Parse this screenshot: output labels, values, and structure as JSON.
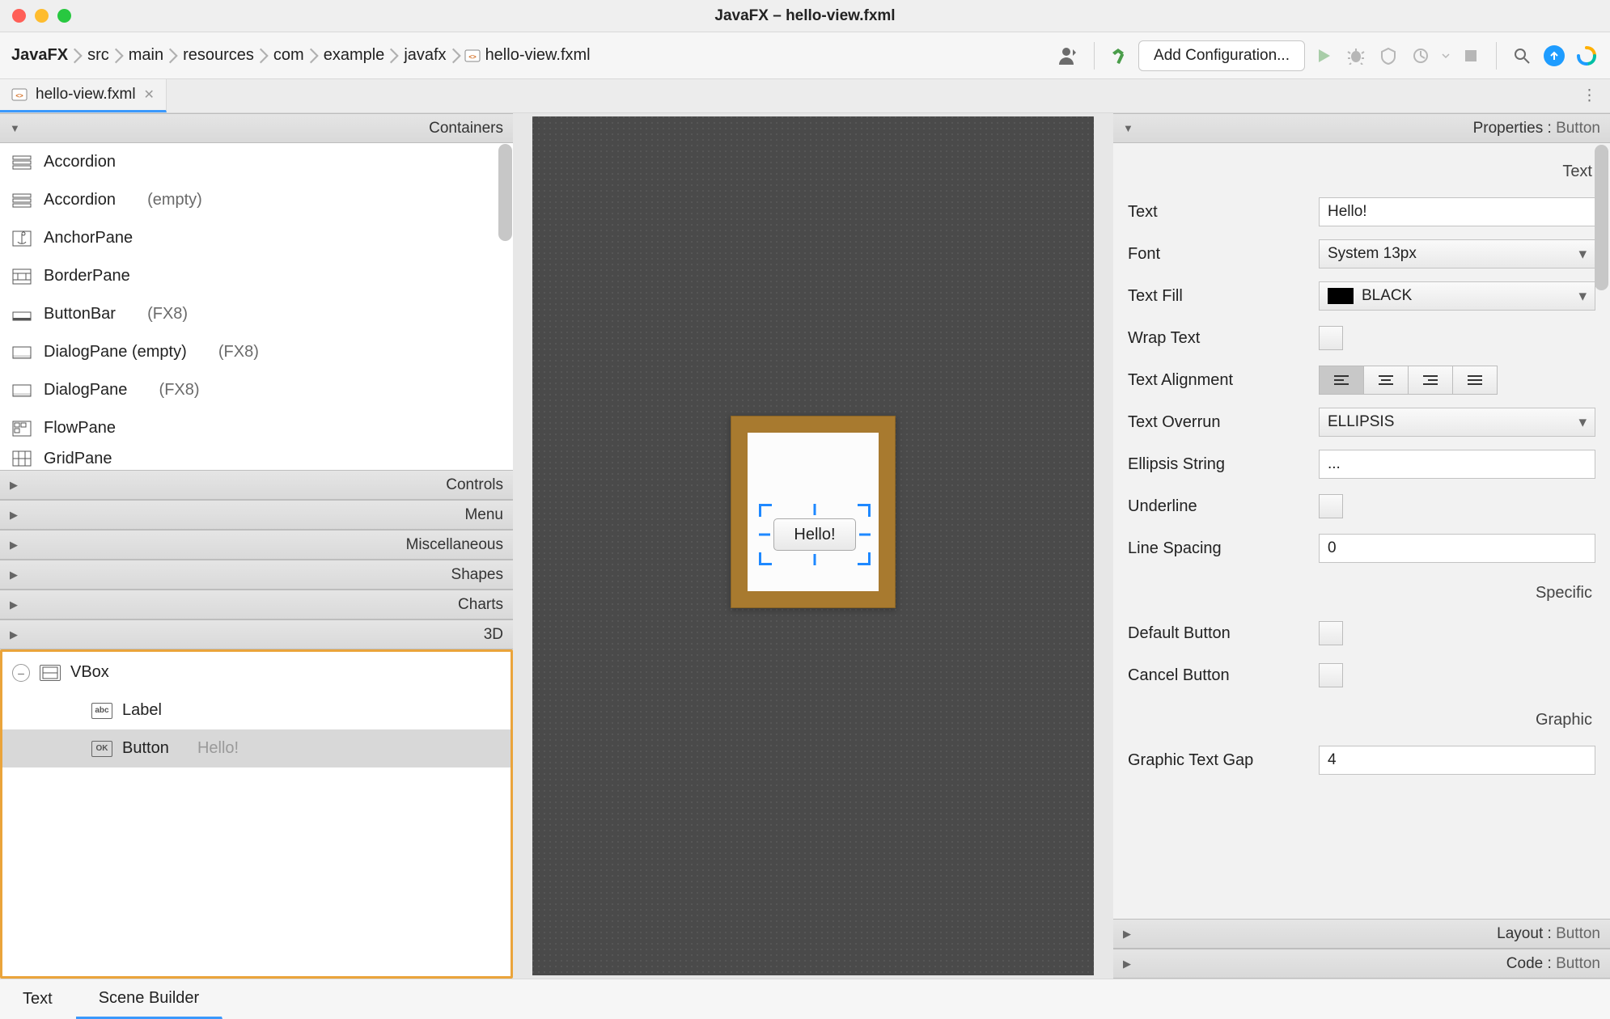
{
  "titlebar": {
    "title": "JavaFX – hello-view.fxml"
  },
  "breadcrumb": [
    "JavaFX",
    "src",
    "main",
    "resources",
    "com",
    "example",
    "javafx",
    "hello-view.fxml"
  ],
  "toolbar": {
    "config_label": "Add Configuration..."
  },
  "filetab": {
    "name": "hello-view.fxml"
  },
  "library": {
    "containers_label": "Containers",
    "controls_label": "Controls",
    "menu_label": "Menu",
    "misc_label": "Miscellaneous",
    "shapes_label": "Shapes",
    "charts_label": "Charts",
    "3d_label": "3D",
    "items": [
      {
        "name": "Accordion",
        "extra": ""
      },
      {
        "name": "Accordion",
        "extra": "(empty)"
      },
      {
        "name": "AnchorPane",
        "extra": ""
      },
      {
        "name": "BorderPane",
        "extra": ""
      },
      {
        "name": "ButtonBar",
        "extra": "(FX8)"
      },
      {
        "name": "DialogPane (empty)",
        "extra": "(FX8)"
      },
      {
        "name": "DialogPane",
        "extra": "(FX8)"
      },
      {
        "name": "FlowPane",
        "extra": ""
      },
      {
        "name": "GridPane",
        "extra": ""
      }
    ]
  },
  "hierarchy": {
    "root": "VBox",
    "child1": "Label",
    "child2": "Button",
    "child2_text": "Hello!"
  },
  "canvas": {
    "button_text": "Hello!"
  },
  "properties": {
    "panel_label": "Properties",
    "panel_sub": "Button",
    "group_text": "Text",
    "group_specific": "Specific",
    "group_graphic": "Graphic",
    "text_label": "Text",
    "text_value": "Hello!",
    "font_label": "Font",
    "font_value": "System 13px",
    "fill_label": "Text Fill",
    "fill_value": "BLACK",
    "wrap_label": "Wrap Text",
    "align_label": "Text Alignment",
    "overrun_label": "Text Overrun",
    "overrun_value": "ELLIPSIS",
    "ellipsis_label": "Ellipsis String",
    "ellipsis_value": "...",
    "underline_label": "Underline",
    "linespacing_label": "Line Spacing",
    "linespacing_value": "0",
    "defaultbtn_label": "Default Button",
    "cancelbtn_label": "Cancel Button",
    "gtg_label": "Graphic Text Gap",
    "gtg_value": "4",
    "layout_label": "Layout",
    "layout_sub": "Button",
    "code_label": "Code",
    "code_sub": "Button"
  },
  "bottom_tabs": {
    "text": "Text",
    "scene_builder": "Scene Builder"
  }
}
